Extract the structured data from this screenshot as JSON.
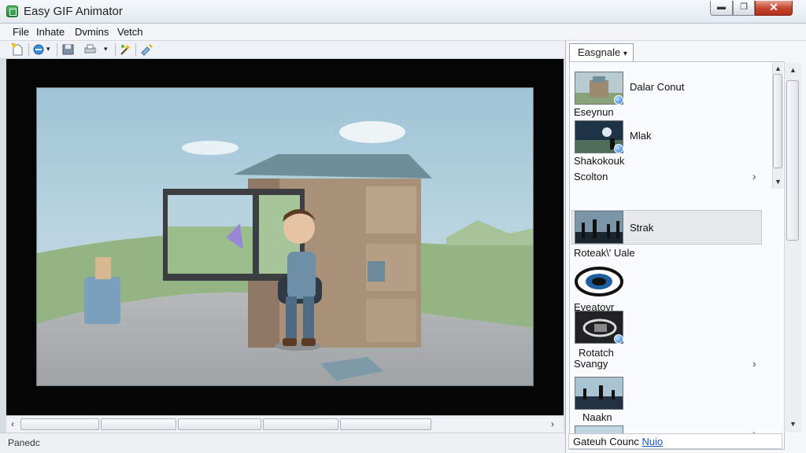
{
  "window": {
    "title": "Easy GIF Animator",
    "minimize": "▬",
    "maximize": "❐",
    "close": "✕"
  },
  "menu": [
    "File",
    "Inhate",
    "Dvmins",
    "Vetch"
  ],
  "toolbar": {
    "icons": [
      "new-file-icon",
      "open-icon",
      "save-icon",
      "print-icon",
      "wizard-icon",
      "effects-icon"
    ],
    "dropdown_glyph": "▾"
  },
  "status": {
    "text": "Panedc"
  },
  "panel": {
    "tab_label": "Easgnale",
    "tab_glyph": "▾",
    "items": [
      {
        "title": "Dalar Conut",
        "caption": "Eseynun"
      },
      {
        "title": "Mlak",
        "caption": "Shakokouk"
      },
      {
        "title": "Scolton",
        "caption": ""
      },
      {
        "title": "Strak",
        "caption": "Roteak\\' Uale"
      },
      {
        "title": "",
        "caption": "Eyeatovr"
      },
      {
        "title": "",
        "caption": "Rotatch"
      },
      {
        "title": "Svangy",
        "caption": ""
      },
      {
        "title": "",
        "caption": "Naakn"
      }
    ],
    "chevron": "›",
    "footer": {
      "text": "Gateuh Counc",
      "link": "Nuio"
    }
  },
  "scroll": {
    "left": "‹",
    "right": "›",
    "up": "▲",
    "down": "▼"
  },
  "colors": {
    "sky": "#c6dde8",
    "grass": "#8fb07a",
    "accent": "#1f73d1",
    "close": "#c2432a"
  }
}
